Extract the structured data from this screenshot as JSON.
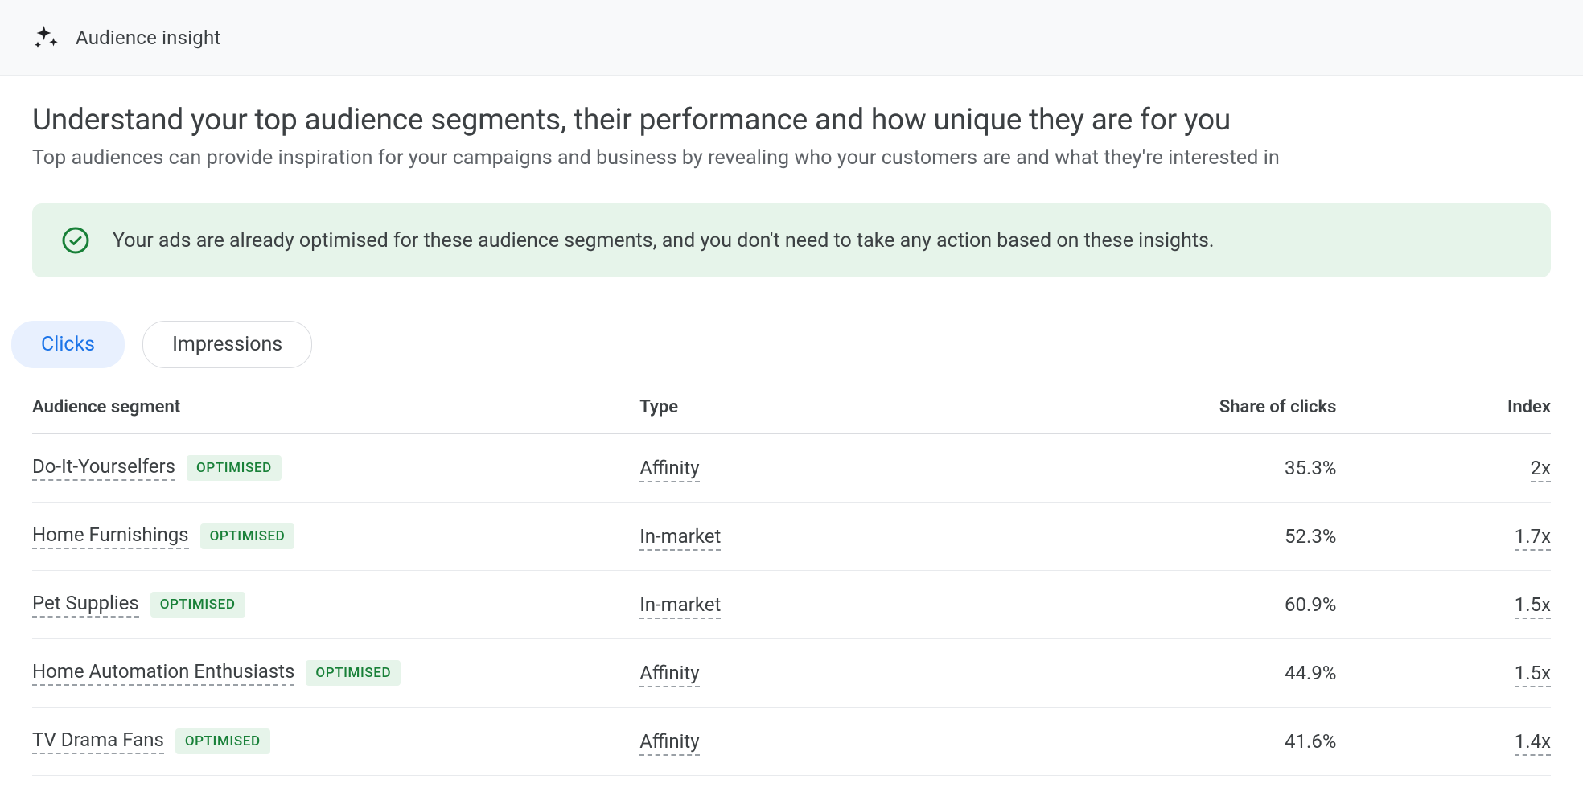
{
  "topbar": {
    "title": "Audience insight"
  },
  "headline": "Understand your top audience segments, their performance and how unique they are for you",
  "subhead": "Top audiences can provide inspiration for your campaigns and business by revealing who your customers are and what they're interested in",
  "banner": {
    "text": "Your ads are already optimised for these audience segments, and you don't need to take any action based on these insights."
  },
  "tabs": {
    "clicks": "Clicks",
    "impressions": "Impressions",
    "active": "clicks"
  },
  "table": {
    "headers": {
      "segment": "Audience segment",
      "type": "Type",
      "share": "Share of clicks",
      "index": "Index"
    },
    "chip_label": "OPTIMISED",
    "rows": [
      {
        "segment": "Do-It-Yourselfers",
        "optimised": true,
        "type": "Affinity",
        "share": "35.3%",
        "index": "2x"
      },
      {
        "segment": "Home Furnishings",
        "optimised": true,
        "type": "In-market",
        "share": "52.3%",
        "index": "1.7x"
      },
      {
        "segment": "Pet Supplies",
        "optimised": true,
        "type": "In-market",
        "share": "60.9%",
        "index": "1.5x"
      },
      {
        "segment": "Home Automation Enthusiasts",
        "optimised": true,
        "type": "Affinity",
        "share": "44.9%",
        "index": "1.5x"
      },
      {
        "segment": "TV Drama Fans",
        "optimised": true,
        "type": "Affinity",
        "share": "41.6%",
        "index": "1.4x"
      }
    ]
  }
}
